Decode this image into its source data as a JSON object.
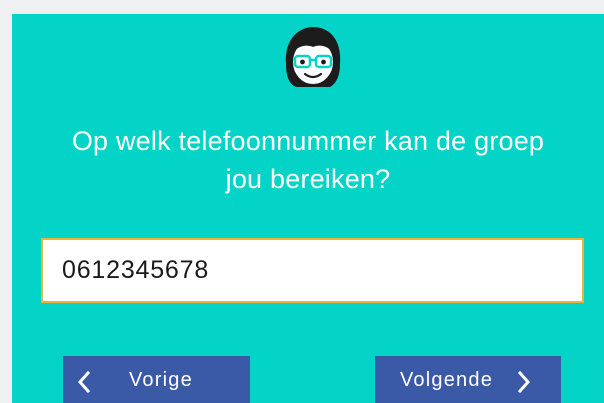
{
  "question": {
    "line1": "Op welk telefoonnummer kan de groep",
    "line2": "jou bereiken?"
  },
  "phone": {
    "value": "0612345678"
  },
  "nav": {
    "prev_label": "Vorige",
    "next_label": "Volgende"
  },
  "icons": {
    "avatar": "girl-with-glasses-avatar-icon",
    "prev": "chevron-left-icon",
    "next": "chevron-right-icon"
  },
  "colors": {
    "background": "#04d4c7",
    "button": "#3a5aa8",
    "input_border": "#e6b63a"
  }
}
